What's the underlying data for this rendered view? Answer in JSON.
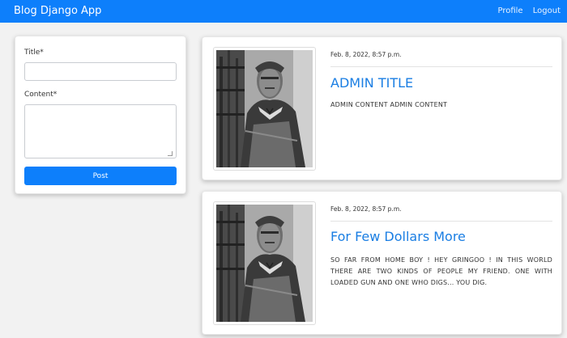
{
  "navbar": {
    "brand": "Blog Django App",
    "links": [
      "Profile",
      "Logout"
    ]
  },
  "form": {
    "title_label": "Title*",
    "title_value": "",
    "content_label": "Content*",
    "content_value": "",
    "submit_label": "Post"
  },
  "posts": [
    {
      "date": "Feb. 8, 2022, 8:57 p.m.",
      "title": "ADMIN TITLE",
      "content": "ADMIN CONTENT ADMIN CONTENT",
      "image": "cowboy-poncho-photo"
    },
    {
      "date": "Feb. 8, 2022, 8:57 p.m.",
      "title": "For Few Dollars More",
      "content": "SO FAR FROM HOME BOY ! HEY GRINGOO ! IN THIS WORLD THERE ARE TWO KINDS OF PEOPLE MY FRIEND. ONE WITH LOADED GUN AND ONE WHO DIGS... YOU DIG.",
      "image": "cowboy-poncho-photo"
    }
  ],
  "colors": {
    "accent": "#0d7ffb",
    "title": "#1a7ee3",
    "background": "#f2f2f2"
  }
}
